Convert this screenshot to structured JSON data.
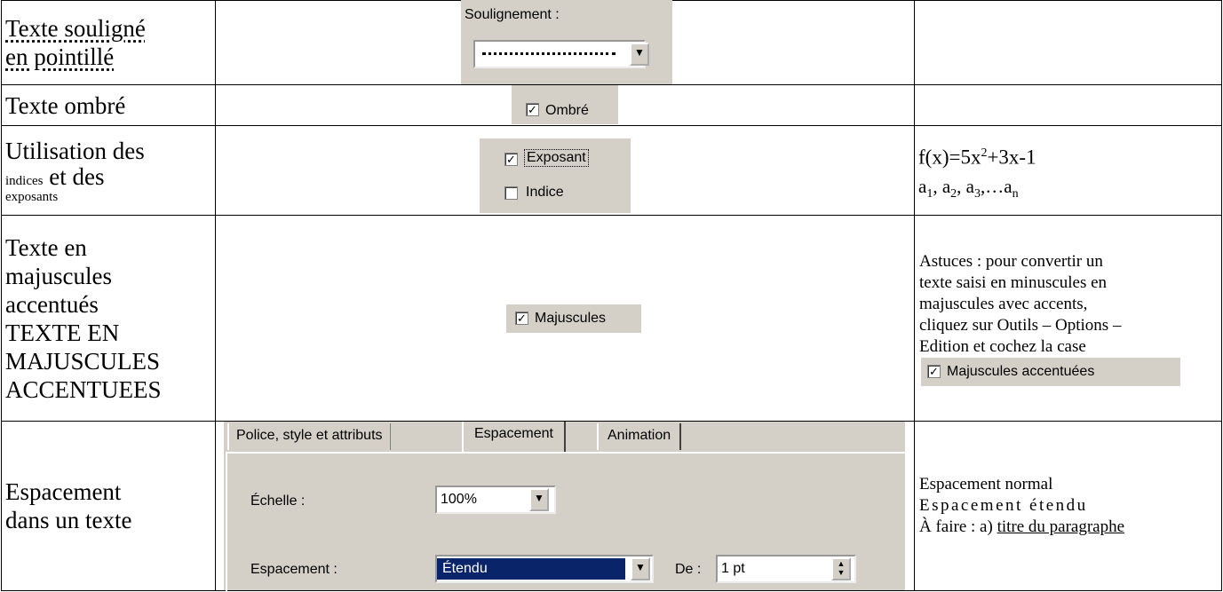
{
  "rows": [
    {
      "label_l1": "Texte souligné",
      "label_l2": "en pointillé",
      "dialog_label": "Soulignement :"
    },
    {
      "label": "Texte ombré",
      "checkbox_label": "Ombré"
    },
    {
      "label_l1": "Utilisation des",
      "label_l2a": "indices",
      "label_l2b": " et des",
      "label_l3": "exposants",
      "checkbox1_label": "Exposant",
      "checkbox2_label": "Indice",
      "formula_a": "f(x)=5x",
      "formula_b": "2",
      "formula_c": "+3x-1",
      "seq": [
        "a",
        "1",
        ", a",
        "2",
        ", a",
        "3",
        ",…a",
        "n"
      ]
    },
    {
      "label_lines": [
        "Texte en",
        "majuscules",
        "accentués",
        "TEXTE EN",
        "MAJUSCULES",
        "ACCENTUEES"
      ],
      "checkbox_label": "Majuscules",
      "tip_lines": [
        "Astuces : pour convertir un",
        "texte saisi en minuscules en",
        "majuscules avec accents,",
        "cliquez sur Outils – Options –",
        "Edition et cochez la case"
      ],
      "tip_checkbox_label": "Majuscules accentuées"
    },
    {
      "label_l1": "Espacement",
      "label_l2": "dans un texte",
      "tabs": [
        "Police, style et attributs",
        "Espacement",
        "Animation"
      ],
      "scale_label": "Échelle :",
      "scale_value": "100%",
      "spacing_label": "Espacement :",
      "spacing_value": "Étendu",
      "by_label": "De :",
      "by_value": "1 pt",
      "note_l1": "Espacement normal",
      "note_l2": "Espacement étendu",
      "note_l3a": "À faire : a) ",
      "note_l3b": "titre du paragraphe"
    }
  ],
  "colors": {
    "dialog_gray": "#d4d0c8",
    "selection": "#0a246a"
  }
}
